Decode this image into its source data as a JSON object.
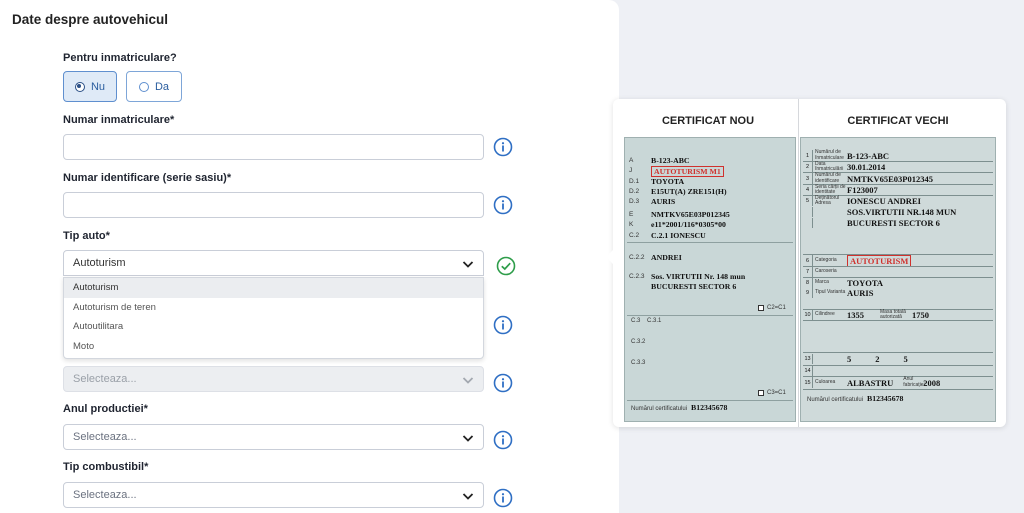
{
  "section_title": "Date despre autovehicul",
  "registration_question": {
    "label": "Pentru inmatriculare?",
    "options": [
      {
        "label": "Nu",
        "selected": true
      },
      {
        "label": "Da",
        "selected": false
      }
    ]
  },
  "plate_number": {
    "label": "Numar inmatriculare*",
    "value": ""
  },
  "vin": {
    "label": "Numar identificare (serie sasiu)*",
    "value": ""
  },
  "vehicle_type": {
    "label": "Tip auto*",
    "value": "Autoturism",
    "options": [
      "Autoturism",
      "Autoturism de teren",
      "Autoutilitara",
      "Moto"
    ]
  },
  "disabled_select": {
    "placeholder": "Selecteaza..."
  },
  "production_year": {
    "label": "Anul productiei*",
    "placeholder": "Selecteaza..."
  },
  "fuel_type": {
    "label": "Tip combustibil*",
    "placeholder": "Selecteaza..."
  },
  "certificate": {
    "new_title": "CERTIFICAT NOU",
    "old_title": "CERTIFICAT VECHI",
    "new": {
      "rows": [
        {
          "k": "A",
          "v": "B-123-ABC"
        },
        {
          "k": "J",
          "v": "AUTOTURISM M1"
        },
        {
          "k": "D.1",
          "v": "TOYOTA"
        },
        {
          "k": "D.2",
          "v": "E15UT(A) ZRE151(H)"
        },
        {
          "k": "D.3",
          "v": "AURIS"
        },
        {
          "k": "E",
          "v": "NMTKV65E03P012345"
        },
        {
          "k": "K",
          "v": "e11*2001/116*0305*00"
        },
        {
          "k": "C.2",
          "v": "C.2.1  IONESCU"
        },
        {
          "k": "C.2.2",
          "v": "ANDREI"
        },
        {
          "k": "C.2.3",
          "v": "Sos. VIRTUTII Nr. 148 mun"
        },
        {
          "k": "",
          "v": "BUCURESTI SECTOR 6"
        }
      ],
      "c2_check": "C2=C1",
      "c31": "C.3.1",
      "c3": "C.3",
      "c32": "C.3.2",
      "c33": "C.3.3",
      "c3_check": "C3=C1",
      "cert_label": "Numărul certificatului",
      "cert_number": "B12345678"
    },
    "old": {
      "plate_label": "Numărul de înmatriculare",
      "plate": "B-123-ABC",
      "date_label": "Data înmatriculării",
      "date": "30.01.2014",
      "vin_label": "Numărul de identificare",
      "vin": "NMTKV65E03P012345",
      "series_label": "Seria cărții de identitate",
      "series": "F123007",
      "owner_label": "Deținătorul Adresa",
      "owner1": "IONESCU ANDREI",
      "owner2": "SOS.VIRTUTII NR.148 MUN",
      "owner3": "BUCURESTI SECTOR 6",
      "category_label": "Categoria",
      "category": "AUTOTURISM",
      "body_label": "Caroseria",
      "make_label": "Marca",
      "make": "TOYOTA",
      "model_label": "Tipul Varianta",
      "model": "AURIS",
      "cc_label": "Cilindree",
      "cc": "1355",
      "mass_label": "Masa totală autorizată",
      "mass": "1750",
      "seats": "5",
      "doors": "2",
      "wheels": "5",
      "color_label": "Culoarea",
      "color": "ALBASTRU",
      "year_label": "Anul fabricației",
      "year": "2008",
      "cert_label": "Numărul certificatului",
      "cert_number": "B12345678"
    }
  }
}
